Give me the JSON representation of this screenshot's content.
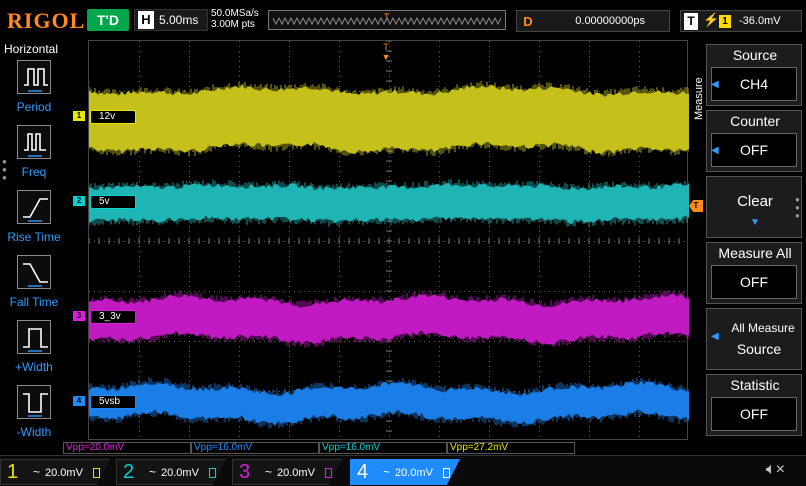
{
  "header": {
    "logo": "RIGOL",
    "run_state": "T'D",
    "horizontal_letter": "H",
    "timebase": "5.00ms",
    "sample_rate": "50.0MSa/s",
    "memory_depth": "3.00M pts",
    "mem_trigger_glyph": "T",
    "delay_letter": "D",
    "delay_value": "0.00000000ps",
    "trigger_letter": "T",
    "trigger_edge_glyph": "⚡",
    "trigger_source": "1",
    "trigger_level": "-36.0mV"
  },
  "left_menu": {
    "title": "Horizontal",
    "items": [
      {
        "label": "Period",
        "icon": "period-icon"
      },
      {
        "label": "Freq",
        "icon": "frequency-icon"
      },
      {
        "label": "Rise Time",
        "icon": "rise-time-icon"
      },
      {
        "label": "Fall Time",
        "icon": "fall-time-icon"
      },
      {
        "label": "+Width",
        "icon": "positive-width-icon"
      },
      {
        "label": "-Width",
        "icon": "negative-width-icon"
      }
    ]
  },
  "channels": [
    {
      "num": "1",
      "label": "12v",
      "color": "#c6c11a",
      "marker_color": "#e6e600",
      "scale": "20.0mV"
    },
    {
      "num": "2",
      "label": "5v",
      "color": "#1fb5b5",
      "marker_color": "#00d2d2",
      "scale": "20.0mV"
    },
    {
      "num": "3",
      "label": "3_3v",
      "color": "#c21ac2",
      "marker_color": "#e01be0",
      "scale": "20.0mV"
    },
    {
      "num": "4",
      "label": "5vsb",
      "color": "#1a7ee6",
      "marker_color": "#1e8cff",
      "scale": "20.0mV"
    }
  ],
  "trigger_pointer": "T",
  "top_trigger_glyph": "T",
  "measurements": [
    {
      "text": "Vpp=20.0mV",
      "color": "#e01be0"
    },
    {
      "text": "Vpp=16.0mV",
      "color": "#1e8cff"
    },
    {
      "text": "Vpp=16.0mV",
      "color": "#00d2d2"
    },
    {
      "text": "Vpp=27.2mV",
      "color": "#e6e600"
    }
  ],
  "right_menu": {
    "section_label": "Measure",
    "items": [
      {
        "title": "Source",
        "value": "CH4"
      },
      {
        "title": "Counter",
        "value": "OFF"
      },
      {
        "title": "Clear",
        "value": ""
      },
      {
        "title": "Measure All",
        "value": "OFF"
      },
      {
        "title": "All Measure",
        "value": "Source"
      },
      {
        "title": "Statistic",
        "value": "OFF"
      }
    ]
  },
  "bottom_bar": {
    "coupling_glyph": "~",
    "sound_icon": "speaker-mute-icon"
  }
}
